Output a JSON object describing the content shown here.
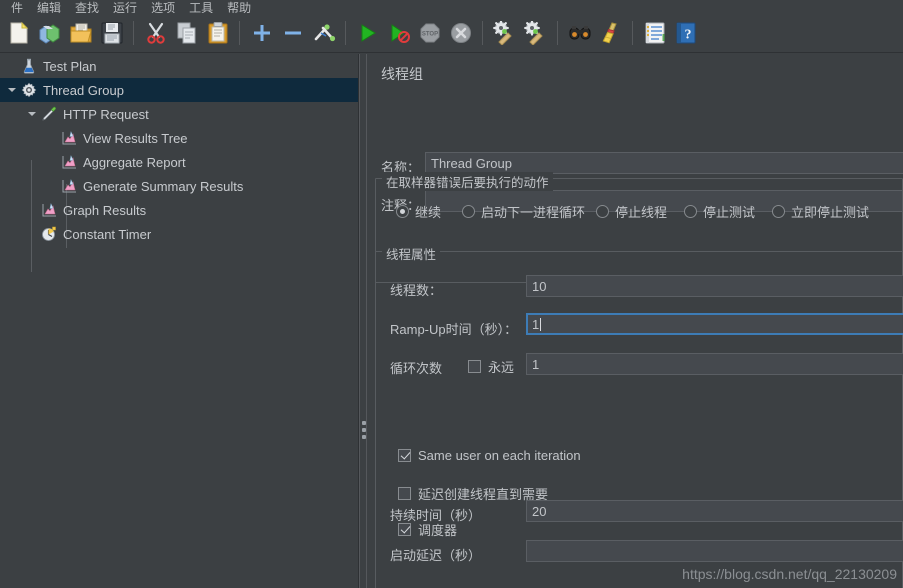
{
  "menubar": {
    "items": [
      {
        "label": "件"
      },
      {
        "label": "编辑"
      },
      {
        "label": "查找"
      },
      {
        "label": "运行"
      },
      {
        "label": "选项"
      },
      {
        "label": "工具"
      },
      {
        "label": "帮助"
      }
    ]
  },
  "toolbar": {
    "buttons": [
      {
        "name": "new-icon",
        "tip": "新建"
      },
      {
        "name": "templates-icon",
        "tip": "模板"
      },
      {
        "name": "open-icon",
        "tip": "打开"
      },
      {
        "name": "save-icon",
        "tip": "保存"
      },
      {
        "name": "cut-icon",
        "tip": "剪切"
      },
      {
        "name": "copy-icon",
        "tip": "复制"
      },
      {
        "name": "paste-icon",
        "tip": "粘贴"
      },
      {
        "name": "expand-all-icon",
        "tip": "展开全部"
      },
      {
        "name": "collapse-all-icon",
        "tip": "收起全部"
      },
      {
        "name": "toggle-icon",
        "tip": "切换"
      },
      {
        "name": "start-icon",
        "tip": "启动"
      },
      {
        "name": "start-no-pauses-icon",
        "tip": "无间隔启动"
      },
      {
        "name": "stop-icon",
        "tip": "停止"
      },
      {
        "name": "shutdown-icon",
        "tip": "关闭"
      },
      {
        "name": "clear-icon",
        "tip": "清除"
      },
      {
        "name": "clear-all-icon",
        "tip": "清除全部"
      },
      {
        "name": "search-icon",
        "tip": "搜索"
      },
      {
        "name": "reset-search-icon",
        "tip": "重置搜索"
      },
      {
        "name": "function-helper-icon",
        "tip": "函数助手"
      },
      {
        "name": "help-icon",
        "tip": "帮助"
      }
    ]
  },
  "tree": {
    "nodes": [
      {
        "label": "Test Plan",
        "depth": 0,
        "icon": "test-plan-icon",
        "twisty": "none",
        "selected": false
      },
      {
        "label": "Thread Group",
        "depth": 1,
        "icon": "thread-group-icon",
        "twisty": "expanded",
        "selected": true
      },
      {
        "label": "HTTP Request",
        "depth": 2,
        "icon": "http-request-icon",
        "twisty": "expanded",
        "selected": false
      },
      {
        "label": "View Results Tree",
        "depth": 3,
        "icon": "listener-icon",
        "twisty": "none",
        "selected": false
      },
      {
        "label": "Aggregate Report",
        "depth": 3,
        "icon": "listener-icon",
        "twisty": "none",
        "selected": false
      },
      {
        "label": "Generate Summary Results",
        "depth": 3,
        "icon": "listener-icon",
        "twisty": "none",
        "selected": false
      },
      {
        "label": "Graph Results",
        "depth": 2,
        "icon": "listener-icon",
        "twisty": "none",
        "selected": false
      },
      {
        "label": "Constant Timer",
        "depth": 2,
        "icon": "timer-icon",
        "twisty": "none",
        "selected": false
      }
    ]
  },
  "config": {
    "title": "线程组",
    "name_label": "名称：",
    "name_value": "Thread Group",
    "comment_label": "注释：",
    "comment_value": "",
    "on_error": {
      "legend": "在取样器错误后要执行的动作",
      "options": [
        {
          "label": "继续",
          "selected": true
        },
        {
          "label": "启动下一进程循环",
          "selected": false
        },
        {
          "label": "停止线程",
          "selected": false
        },
        {
          "label": "停止测试",
          "selected": false
        },
        {
          "label": "立即停止测试",
          "selected": false
        }
      ]
    },
    "thread_props": {
      "legend": "线程属性",
      "num_threads_label": "线程数：",
      "num_threads_value": "10",
      "ramp_up_label": "Ramp-Up时间（秒）：",
      "ramp_up_value": "1",
      "ramp_up_focused": true,
      "loop_count_label": "循环次数",
      "forever_label": "永远",
      "forever_checked": false,
      "loop_count_value": "1",
      "same_user_label": "Same user on each iteration",
      "same_user_checked": true,
      "delayed_start_label": "延迟创建线程直到需要",
      "delayed_start_checked": false,
      "scheduler_label": "调度器",
      "scheduler_checked": true,
      "duration_label": "持续时间（秒）",
      "duration_value": "20",
      "startup_delay_label": "启动延迟（秒）",
      "startup_delay_value": ""
    }
  },
  "watermark": "https://blog.csdn.net/qq_22130209",
  "colors": {
    "panel_bg": "#3c4043",
    "field_bg": "#45494e",
    "selection": "#0f2a3d",
    "focus_border": "#3d7cb6",
    "text": "#c2c5c9"
  }
}
